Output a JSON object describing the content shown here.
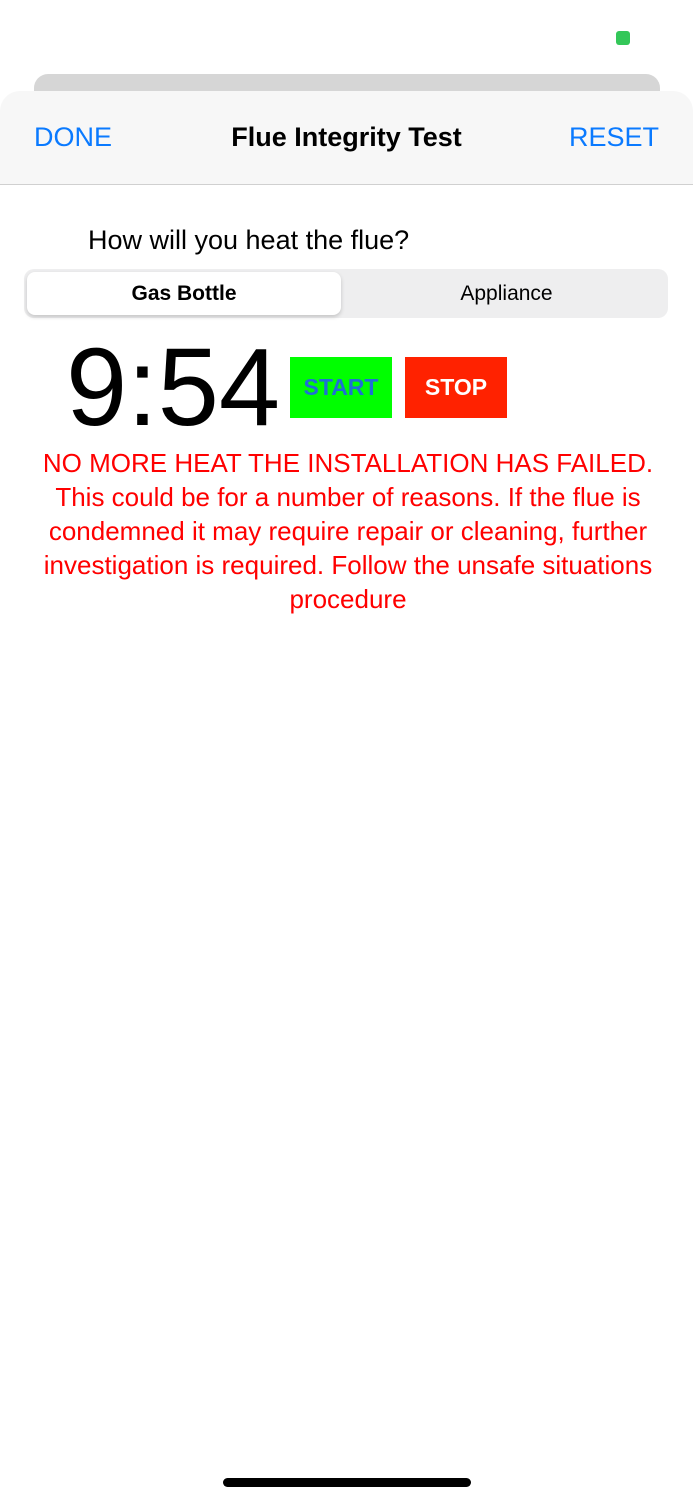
{
  "nav": {
    "done_label": "DONE",
    "title": "Flue Integrity Test",
    "reset_label": "RESET"
  },
  "question": "How will you heat the flue?",
  "segments": [
    {
      "label": "Gas Bottle",
      "selected": true
    },
    {
      "label": "Appliance",
      "selected": false
    }
  ],
  "timer": {
    "display": "9:54"
  },
  "buttons": {
    "start_label": "START",
    "stop_label": "STOP"
  },
  "message": "NO MORE HEAT THE INSTALLATION HAS FAILED. This could be for a number of reasons. If the flue is condemned it may require repair or cleaning, further investigation is required. Follow the unsafe situations procedure",
  "colors": {
    "accent": "#0a7aff",
    "start_bg": "#00ff00",
    "start_text": "#1f6fd4",
    "stop_bg": "#ff2200",
    "stop_text": "#ffffff",
    "message_text": "#ff0000",
    "status_indicator": "#34c759"
  }
}
